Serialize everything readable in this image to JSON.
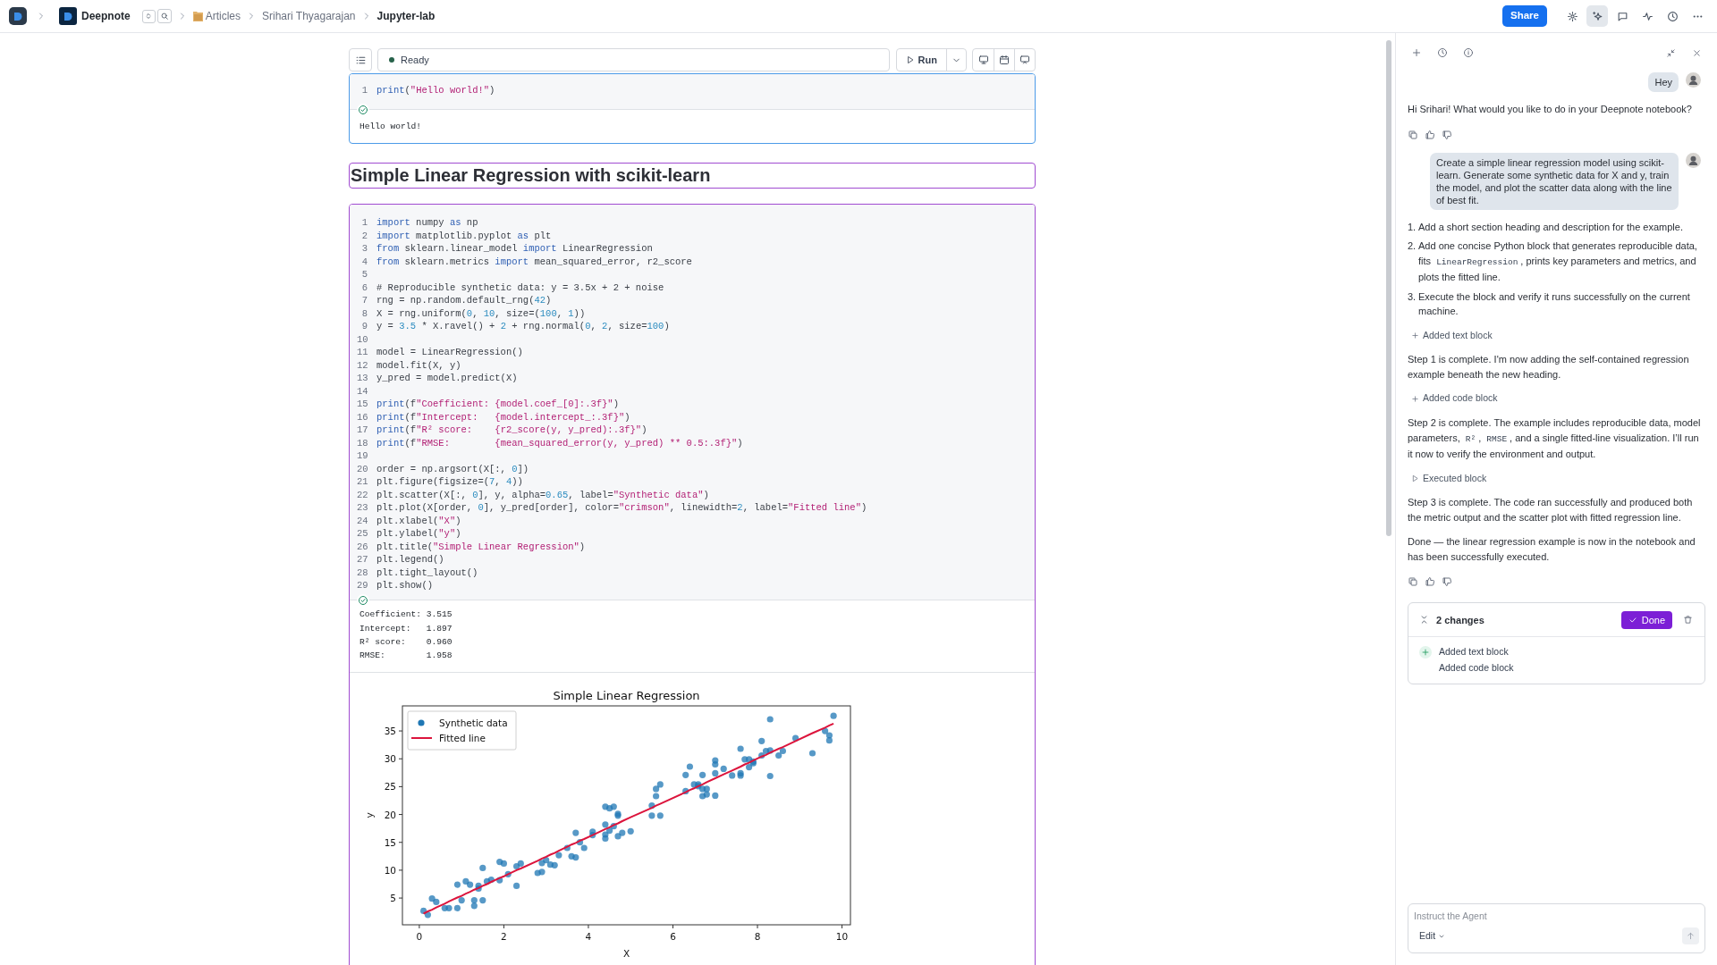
{
  "top_bar": {
    "breadcrumbs": [
      {
        "kind": "workspace",
        "label": "Deepnote"
      },
      {
        "kind": "folder",
        "label": "Articles"
      },
      {
        "kind": "plain",
        "label": "Srihari Thyagarajan"
      },
      {
        "kind": "current",
        "label": "Jupyter-lab"
      }
    ],
    "share_button": "Share",
    "tools": [
      {
        "kind": "settings",
        "selected": false
      },
      {
        "kind": "agent",
        "selected": true
      },
      {
        "kind": "comments",
        "selected": false
      },
      {
        "kind": "activity",
        "selected": false
      },
      {
        "kind": "history",
        "selected": false
      },
      {
        "kind": "more",
        "selected": false
      }
    ]
  },
  "notebook": {
    "status": "Ready",
    "run_button": "Run",
    "cells": [
      {
        "kind": "code",
        "selected": true,
        "agent_added": false,
        "executed": true,
        "lines": [
          {
            "number": "1",
            "tokens": [
              {
                "kind": "keyword",
                "text": "print"
              },
              {
                "kind": "plain",
                "text": "("
              },
              {
                "kind": "string",
                "text": "\"Hello world!\""
              },
              {
                "kind": "plain",
                "text": ")"
              }
            ]
          }
        ],
        "output": [
          "Hello world!"
        ]
      },
      {
        "kind": "heading",
        "selected": false,
        "agent_added": true,
        "text": "Simple Linear Regression with scikit-learn"
      },
      {
        "kind": "code",
        "selected": false,
        "agent_added": true,
        "executed": true,
        "lines": [
          {
            "number": "1",
            "tokens": [
              {
                "kind": "keyword",
                "text": "import"
              },
              {
                "kind": "plain",
                "text": " numpy "
              },
              {
                "kind": "keyword",
                "text": "as"
              },
              {
                "kind": "plain",
                "text": " np"
              }
            ]
          },
          {
            "number": "2",
            "tokens": [
              {
                "kind": "keyword",
                "text": "import"
              },
              {
                "kind": "plain",
                "text": " matplotlib.pyplot "
              },
              {
                "kind": "keyword",
                "text": "as"
              },
              {
                "kind": "plain",
                "text": " plt"
              }
            ]
          },
          {
            "number": "3",
            "tokens": [
              {
                "kind": "keyword",
                "text": "from"
              },
              {
                "kind": "plain",
                "text": " sklearn.linear_model "
              },
              {
                "kind": "keyword",
                "text": "import"
              },
              {
                "kind": "plain",
                "text": " LinearRegression"
              }
            ]
          },
          {
            "number": "4",
            "tokens": [
              {
                "kind": "keyword",
                "text": "from"
              },
              {
                "kind": "plain",
                "text": " sklearn.metrics "
              },
              {
                "kind": "keyword",
                "text": "import"
              },
              {
                "kind": "plain",
                "text": " mean_squared_error, r2_score"
              }
            ]
          },
          {
            "number": "5"
          },
          {
            "number": "6",
            "tokens": [
              {
                "kind": "plain",
                "text": "# Reproducible synthetic data: y = 3.5x + 2 + noise"
              }
            ]
          },
          {
            "number": "7",
            "tokens": [
              {
                "kind": "plain",
                "text": "rng = np.random.default_rng("
              },
              {
                "kind": "number",
                "text": "42"
              },
              {
                "kind": "plain",
                "text": ")"
              }
            ]
          },
          {
            "number": "8",
            "tokens": [
              {
                "kind": "plain",
                "text": "X = rng.uniform("
              },
              {
                "kind": "number",
                "text": "0"
              },
              {
                "kind": "plain",
                "text": ", "
              },
              {
                "kind": "number",
                "text": "10"
              },
              {
                "kind": "plain",
                "text": ", size=("
              },
              {
                "kind": "number",
                "text": "100"
              },
              {
                "kind": "plain",
                "text": ", "
              },
              {
                "kind": "number",
                "text": "1"
              },
              {
                "kind": "plain",
                "text": "))"
              }
            ]
          },
          {
            "number": "9",
            "tokens": [
              {
                "kind": "plain",
                "text": "y = "
              },
              {
                "kind": "number",
                "text": "3.5"
              },
              {
                "kind": "plain",
                "text": " * X.ravel() + "
              },
              {
                "kind": "number",
                "text": "2"
              },
              {
                "kind": "plain",
                "text": " + rng.normal("
              },
              {
                "kind": "number",
                "text": "0"
              },
              {
                "kind": "plain",
                "text": ", "
              },
              {
                "kind": "number",
                "text": "2"
              },
              {
                "kind": "plain",
                "text": ", size="
              },
              {
                "kind": "number",
                "text": "100"
              },
              {
                "kind": "plain",
                "text": ")"
              }
            ]
          },
          {
            "number": "10"
          },
          {
            "number": "11",
            "tokens": [
              {
                "kind": "plain",
                "text": "model = LinearRegression()"
              }
            ]
          },
          {
            "number": "12",
            "tokens": [
              {
                "kind": "plain",
                "text": "model.fit(X, y)"
              }
            ]
          },
          {
            "number": "13",
            "tokens": [
              {
                "kind": "plain",
                "text": "y_pred = model.predict(X)"
              }
            ]
          },
          {
            "number": "14"
          },
          {
            "number": "15",
            "tokens": [
              {
                "kind": "keyword",
                "text": "print"
              },
              {
                "kind": "plain",
                "text": "(f"
              },
              {
                "kind": "string",
                "text": "\"Coefficient: {model.coef_[0]:.3f}\""
              },
              {
                "kind": "plain",
                "text": ")"
              }
            ]
          },
          {
            "number": "16",
            "tokens": [
              {
                "kind": "keyword",
                "text": "print"
              },
              {
                "kind": "plain",
                "text": "(f"
              },
              {
                "kind": "string",
                "text": "\"Intercept:   {model.intercept_:.3f}\""
              },
              {
                "kind": "plain",
                "text": ")"
              }
            ]
          },
          {
            "number": "17",
            "tokens": [
              {
                "kind": "keyword",
                "text": "print"
              },
              {
                "kind": "plain",
                "text": "(f"
              },
              {
                "kind": "string",
                "text": "\"R² score:    {r2_score(y, y_pred):.3f}\""
              },
              {
                "kind": "plain",
                "text": ")"
              }
            ]
          },
          {
            "number": "18",
            "tokens": [
              {
                "kind": "keyword",
                "text": "print"
              },
              {
                "kind": "plain",
                "text": "(f"
              },
              {
                "kind": "string",
                "text": "\"RMSE:        {mean_squared_error(y, y_pred) ** 0.5:.3f}\""
              },
              {
                "kind": "plain",
                "text": ")"
              }
            ]
          },
          {
            "number": "19"
          },
          {
            "number": "20",
            "tokens": [
              {
                "kind": "plain",
                "text": "order = np.argsort(X[:, "
              },
              {
                "kind": "number",
                "text": "0"
              },
              {
                "kind": "plain",
                "text": "])"
              }
            ]
          },
          {
            "number": "21",
            "tokens": [
              {
                "kind": "plain",
                "text": "plt.figure(figsize=("
              },
              {
                "kind": "number",
                "text": "7"
              },
              {
                "kind": "plain",
                "text": ", "
              },
              {
                "kind": "number",
                "text": "4"
              },
              {
                "kind": "plain",
                "text": "))"
              }
            ]
          },
          {
            "number": "22",
            "tokens": [
              {
                "kind": "plain",
                "text": "plt.scatter(X[:, "
              },
              {
                "kind": "number",
                "text": "0"
              },
              {
                "kind": "plain",
                "text": "], y, alpha="
              },
              {
                "kind": "number",
                "text": "0.65"
              },
              {
                "kind": "plain",
                "text": ", label="
              },
              {
                "kind": "string",
                "text": "\"Synthetic data\""
              },
              {
                "kind": "plain",
                "text": ")"
              }
            ]
          },
          {
            "number": "23",
            "tokens": [
              {
                "kind": "plain",
                "text": "plt.plot(X[order, "
              },
              {
                "kind": "number",
                "text": "0"
              },
              {
                "kind": "plain",
                "text": "], y_pred[order], color="
              },
              {
                "kind": "string",
                "text": "\"crimson\""
              },
              {
                "kind": "plain",
                "text": ", linewidth="
              },
              {
                "kind": "number",
                "text": "2"
              },
              {
                "kind": "plain",
                "text": ", label="
              },
              {
                "kind": "string",
                "text": "\"Fitted line\""
              },
              {
                "kind": "plain",
                "text": ")"
              }
            ]
          },
          {
            "number": "24",
            "tokens": [
              {
                "kind": "plain",
                "text": "plt.xlabel("
              },
              {
                "kind": "string",
                "text": "\"X\""
              },
              {
                "kind": "plain",
                "text": ")"
              }
            ]
          },
          {
            "number": "25",
            "tokens": [
              {
                "kind": "plain",
                "text": "plt.ylabel("
              },
              {
                "kind": "string",
                "text": "\"y\""
              },
              {
                "kind": "plain",
                "text": ")"
              }
            ]
          },
          {
            "number": "26",
            "tokens": [
              {
                "kind": "plain",
                "text": "plt.title("
              },
              {
                "kind": "string",
                "text": "\"Simple Linear Regression\""
              },
              {
                "kind": "plain",
                "text": ")"
              }
            ]
          },
          {
            "number": "27",
            "tokens": [
              {
                "kind": "plain",
                "text": "plt.legend()"
              }
            ]
          },
          {
            "number": "28",
            "tokens": [
              {
                "kind": "plain",
                "text": "plt.tight_layout()"
              }
            ]
          },
          {
            "number": "29",
            "tokens": [
              {
                "kind": "plain",
                "text": "plt.show()"
              }
            ]
          }
        ],
        "output": [
          "Coefficient: 3.515",
          "Intercept:   1.897",
          "R² score:    0.960",
          "RMSE:        1.958"
        ],
        "chart_data": {
          "type": "scatter",
          "title": "Simple Linear Regression",
          "xlabel": "X",
          "ylabel": "y",
          "xlim": [
            -0.4,
            10.2
          ],
          "ylim": [
            0.2,
            39.5
          ],
          "xticks": [
            0,
            2,
            4,
            6,
            8,
            10
          ],
          "yticks": [
            5,
            10,
            15,
            20,
            25,
            30,
            35
          ],
          "legend": "upper left",
          "x": [
            0.1,
            0.2,
            0.3,
            0.4,
            0.6,
            0.7,
            0.9,
            0.9,
            1.0,
            1.1,
            1.2,
            1.3,
            1.3,
            1.4,
            1.4,
            1.5,
            1.5,
            1.6,
            1.7,
            1.9,
            1.9,
            2.0,
            2.1,
            2.3,
            2.3,
            2.4,
            2.8,
            2.9,
            2.9,
            3.0,
            3.1,
            3.2,
            3.3,
            3.5,
            3.6,
            3.7,
            3.7,
            3.8,
            3.9,
            4.1,
            4.1,
            4.4,
            4.4,
            4.4,
            4.4,
            4.5,
            4.5,
            4.6,
            4.6,
            4.7,
            4.7,
            4.7,
            4.8,
            5.0,
            5.5,
            5.5,
            5.6,
            5.6,
            5.7,
            5.7,
            6.3,
            6.3,
            6.4,
            6.5,
            6.6,
            6.6,
            6.7,
            6.7,
            6.7,
            6.8,
            6.8,
            7.0,
            7.0,
            7.0,
            7.0,
            7.2,
            7.4,
            7.6,
            7.6,
            7.6,
            7.7,
            7.8,
            7.8,
            7.9,
            7.9,
            8.1,
            8.1,
            8.2,
            8.3,
            8.3,
            8.3,
            8.5,
            8.6,
            8.9,
            9.3,
            9.6,
            9.7,
            9.7,
            9.8
          ],
          "series": [
            {
              "name": "Synthetic data",
              "type": "scatter",
              "color": "#1f77b4",
              "values": [
                2.7,
                2.0,
                4.9,
                4.3,
                3.2,
                3.2,
                3.2,
                7.4,
                4.6,
                8.0,
                7.4,
                4.6,
                3.6,
                7.2,
                6.7,
                4.6,
                10.4,
                8.0,
                8.3,
                8.2,
                11.5,
                11.2,
                9.3,
                7.2,
                10.7,
                11.2,
                9.5,
                11.3,
                9.7,
                11.8,
                11.0,
                10.9,
                12.7,
                14.0,
                12.5,
                16.7,
                12.3,
                15.0,
                14.0,
                16.9,
                16.3,
                18.2,
                21.4,
                15.7,
                16.4,
                21.1,
                17.1,
                17.9,
                21.4,
                20.1,
                19.8,
                16.1,
                16.7,
                17.0,
                21.6,
                19.8,
                24.6,
                23.3,
                19.8,
                25.4,
                24.2,
                27.1,
                28.6,
                25.4,
                25.4,
                25.1,
                24.6,
                23.3,
                27.1,
                24.6,
                23.6,
                29.7,
                29.0,
                27.4,
                23.4,
                28.2,
                27.0,
                31.8,
                27.0,
                27.4,
                29.9,
                28.5,
                29.9,
                29.2,
                29.5,
                30.6,
                33.2,
                31.4,
                31.5,
                37.1,
                26.9,
                30.6,
                31.4,
                33.7,
                31.0,
                35.0,
                34.2,
                33.3,
                37.7
              ]
            },
            {
              "name": "Fitted line",
              "type": "line",
              "color": "#dc143c",
              "values": [
                2.2,
                2.6,
                2.9,
                3.3,
                4.0,
                4.4,
                5.1,
                5.1,
                5.4,
                5.8,
                6.1,
                6.5,
                6.5,
                6.8,
                6.8,
                7.2,
                7.2,
                7.5,
                7.9,
                8.6,
                8.6,
                8.9,
                9.3,
                10.0,
                10.0,
                10.3,
                11.7,
                12.1,
                12.1,
                12.4,
                12.8,
                13.1,
                13.5,
                14.2,
                14.6,
                14.9,
                14.9,
                15.3,
                15.6,
                16.3,
                16.3,
                17.4,
                17.4,
                17.4,
                17.4,
                17.7,
                17.7,
                18.1,
                18.1,
                18.4,
                18.4,
                18.4,
                18.8,
                19.5,
                21.2,
                21.2,
                21.6,
                21.6,
                21.9,
                21.9,
                24.0,
                24.0,
                24.4,
                24.7,
                25.1,
                25.1,
                25.4,
                25.4,
                25.4,
                25.8,
                25.8,
                26.5,
                26.5,
                26.5,
                26.5,
                27.2,
                27.9,
                28.6,
                28.6,
                28.6,
                29.0,
                29.3,
                29.3,
                29.7,
                29.7,
                30.4,
                30.4,
                30.7,
                31.1,
                31.1,
                31.1,
                31.8,
                32.1,
                33.2,
                34.6,
                35.6,
                36.0,
                36.0,
                36.3
              ]
            }
          ]
        }
      }
    ]
  },
  "agent_panel": {
    "messages": [
      {
        "kind": "user",
        "text": "Hey"
      },
      {
        "kind": "assistant",
        "parts": [
          {
            "kind": "text",
            "text": "Hi Srihari! What would you like to do in your Deepnote notebook?"
          }
        ]
      },
      {
        "kind": "feedback"
      },
      {
        "kind": "user",
        "text": "Create a simple linear regression model using scikit-learn. Generate some synthetic data for X and y, train the model, and plot the scatter data along with the line of best fit."
      },
      {
        "kind": "steps",
        "items": [
          {
            "number": "1.",
            "parts": [
              {
                "kind": "text",
                "text": "Add a short section heading and description for the example."
              }
            ]
          },
          {
            "number": "2.",
            "parts": [
              {
                "kind": "text",
                "text": "Add one concise Python block that generates reproducible data, fits "
              },
              {
                "kind": "code",
                "text": "LinearRegression"
              },
              {
                "kind": "text",
                "text": ", prints key parameters and metrics, and plots the fitted line."
              }
            ]
          },
          {
            "number": "3.",
            "parts": [
              {
                "kind": "text",
                "text": "Execute the block and verify it runs successfully on the current machine."
              }
            ]
          }
        ]
      },
      {
        "kind": "action_added",
        "text": "Added text block"
      },
      {
        "kind": "assistant",
        "parts": [
          {
            "kind": "text",
            "text": "Step 1 is complete. I'm now adding the self-contained regression example beneath the new heading."
          }
        ]
      },
      {
        "kind": "action_added",
        "text": "Added code block"
      },
      {
        "kind": "assistant",
        "parts": [
          {
            "kind": "text",
            "text": "Step 2 is complete. The example includes reproducible data, model parameters, "
          },
          {
            "kind": "code",
            "text": "R²"
          },
          {
            "kind": "text",
            "text": ", "
          },
          {
            "kind": "code",
            "text": "RMSE"
          },
          {
            "kind": "text",
            "text": ", and a single fitted-line visualization. I’ll run it now to verify the environment and output."
          }
        ]
      },
      {
        "kind": "action_executed",
        "text": "Executed block"
      },
      {
        "kind": "assistant",
        "parts": [
          {
            "kind": "text",
            "text": "Step 3 is complete. The code ran successfully and produced both the metric output and the scatter plot with fitted regression line."
          }
        ]
      },
      {
        "kind": "assistant",
        "parts": [
          {
            "kind": "text",
            "text": "Done — the linear regression example is now in the notebook and has been successfully executed."
          }
        ]
      },
      {
        "kind": "feedback"
      }
    ],
    "changes": {
      "title": "2 changes",
      "done_button": "Done",
      "items": [
        "Added text block",
        "Added code block"
      ]
    },
    "composer": {
      "placeholder": "Instruct the Agent",
      "mode": "Edit"
    }
  }
}
